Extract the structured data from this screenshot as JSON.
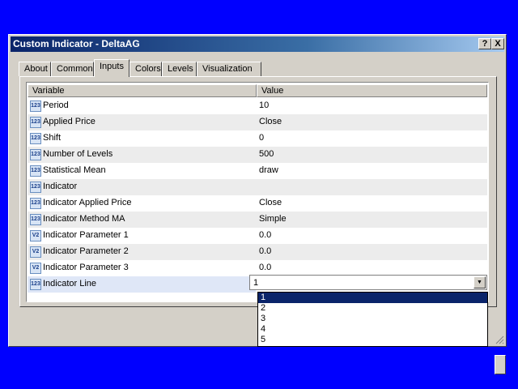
{
  "window": {
    "title": "Custom Indicator - DeltaAG",
    "help_label": "?",
    "close_label": "X"
  },
  "tabs": [
    {
      "label": "About",
      "active": false
    },
    {
      "label": "Common",
      "active": false
    },
    {
      "label": "Inputs",
      "active": true
    },
    {
      "label": "Colors",
      "active": false
    },
    {
      "label": "Levels",
      "active": false
    },
    {
      "label": "Visualization",
      "active": false
    }
  ],
  "grid": {
    "columns": [
      "Variable",
      "Value"
    ],
    "rows": [
      {
        "icon": "123",
        "name": "Period",
        "value": "10"
      },
      {
        "icon": "123",
        "name": "Applied Price",
        "value": "Close"
      },
      {
        "icon": "123",
        "name": "Shift",
        "value": "0"
      },
      {
        "icon": "123",
        "name": "Number of Levels",
        "value": "500"
      },
      {
        "icon": "123",
        "name": "Statistical Mean",
        "value": "draw"
      },
      {
        "icon": "123",
        "name": "Indicator",
        "value": ""
      },
      {
        "icon": "123",
        "name": "Indicator Applied Price",
        "value": "Close"
      },
      {
        "icon": "123",
        "name": "Indicator Method MA",
        "value": "Simple"
      },
      {
        "icon": "V2",
        "name": "Indicator Parameter 1",
        "value": "0.0"
      },
      {
        "icon": "V2",
        "name": "Indicator Parameter 2",
        "value": "0.0"
      },
      {
        "icon": "V2",
        "name": "Indicator Parameter 3",
        "value": "0.0"
      },
      {
        "icon": "123",
        "name": "Indicator Line",
        "value": ""
      }
    ]
  },
  "combo": {
    "value": "1",
    "options": [
      "1",
      "2",
      "3",
      "4",
      "5"
    ],
    "highlighted_index": 0
  },
  "colors": {
    "desktop": "#0000ff",
    "dialog": "#d4d0c8",
    "highlight": "#0a246a"
  }
}
